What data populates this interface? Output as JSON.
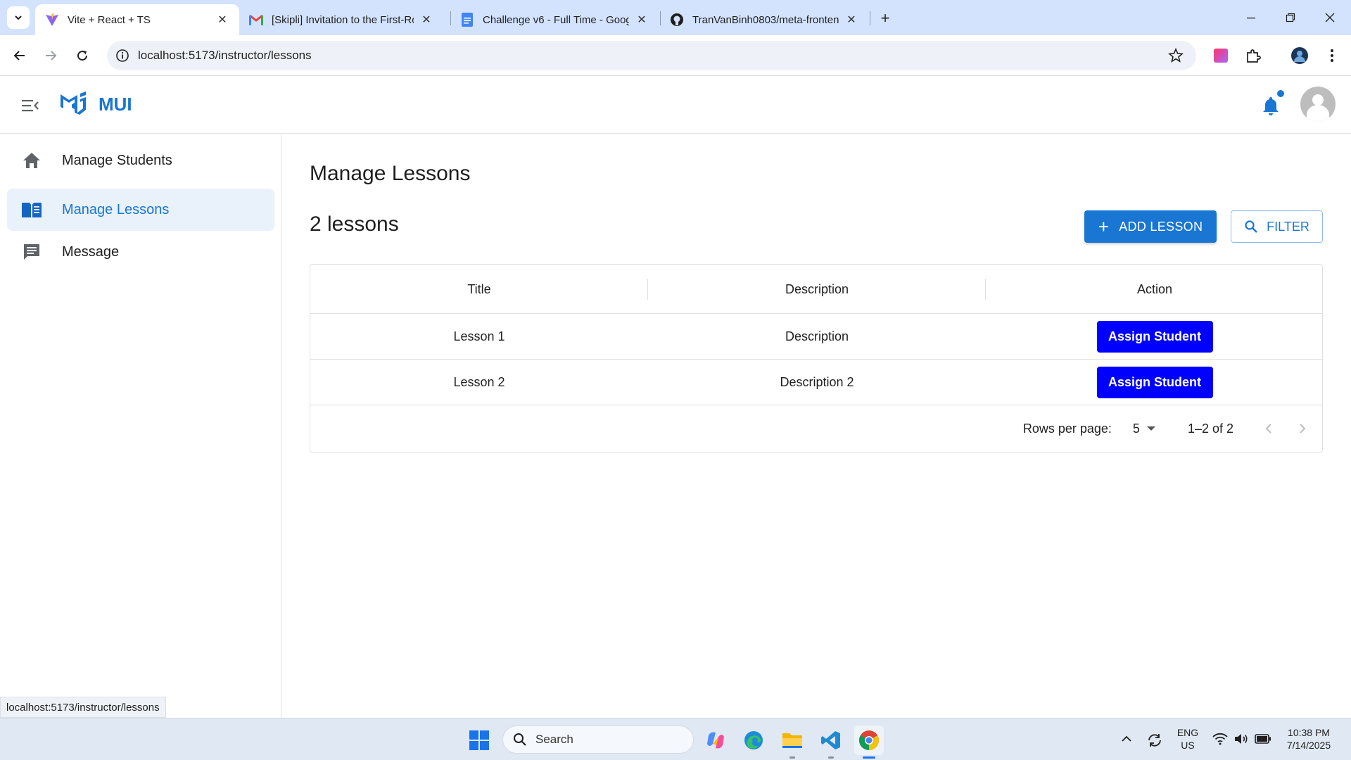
{
  "browser": {
    "tabs": [
      {
        "title": "Vite + React + TS",
        "favicon": "vite-icon",
        "active": true
      },
      {
        "title": "[Skipli] Invitation to the First-Ro",
        "favicon": "gmail-icon",
        "active": false
      },
      {
        "title": "Challenge v6 - Full Time - Goog",
        "favicon": "docs-icon",
        "active": false
      },
      {
        "title": "TranVanBinh0803/meta-fronten",
        "favicon": "github-icon",
        "active": false
      }
    ],
    "url": "localhost:5173/instructor/lessons",
    "status_url": "localhost:5173/instructor/lessons"
  },
  "app": {
    "logo_text": "MUI",
    "brand_color": "#1976d2",
    "sidebar": {
      "items": [
        {
          "label": "Manage Students",
          "icon": "home-icon",
          "active": false
        },
        {
          "label": "Manage Lessons",
          "icon": "book-icon",
          "active": true
        },
        {
          "label": "Message",
          "icon": "message-icon",
          "active": false
        }
      ]
    },
    "main": {
      "title": "Manage Lessons",
      "count_label": "2 lessons",
      "add_button": "ADD LESSON",
      "filter_button": "FILTER",
      "table": {
        "columns": [
          "Title",
          "Description",
          "Action"
        ],
        "rows": [
          {
            "title": "Lesson 1",
            "description": "Description",
            "action": "Assign Student"
          },
          {
            "title": "Lesson 2",
            "description": "Description 2",
            "action": "Assign Student"
          }
        ],
        "footer": {
          "rows_per_page_label": "Rows per page:",
          "rows_per_page_value": "5",
          "range": "1–2 of 2"
        }
      }
    }
  },
  "taskbar": {
    "search_placeholder": "Search",
    "lang_line1": "ENG",
    "lang_line2": "US",
    "time": "10:38 PM",
    "date": "7/14/2025"
  }
}
